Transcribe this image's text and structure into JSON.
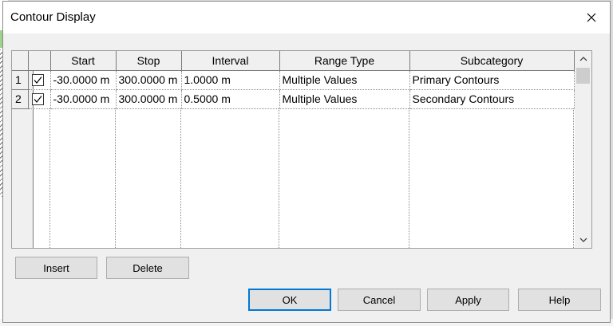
{
  "dialog": {
    "title": "Contour Display"
  },
  "table": {
    "columns": [
      "Start",
      "Stop",
      "Interval",
      "Range Type",
      "Subcategory"
    ],
    "rows": [
      {
        "num": "1",
        "checked": true,
        "start": "-30.0000 m",
        "stop": "300.0000 m",
        "interval": "1.0000 m",
        "range_type": "Multiple Values",
        "subcategory": "Primary Contours"
      },
      {
        "num": "2",
        "checked": true,
        "start": "-30.0000 m",
        "stop": "300.0000 m",
        "interval": "0.5000 m",
        "range_type": "Multiple Values",
        "subcategory": "Secondary Contours"
      }
    ]
  },
  "buttons": {
    "insert": "Insert",
    "delete": "Delete",
    "ok": "OK",
    "cancel": "Cancel",
    "apply": "Apply",
    "help": "Help"
  },
  "icons": {
    "close": "close-icon",
    "checkbox": "checkmark-icon",
    "scroll_up": "chevron-up-icon",
    "scroll_down": "chevron-down-icon"
  }
}
